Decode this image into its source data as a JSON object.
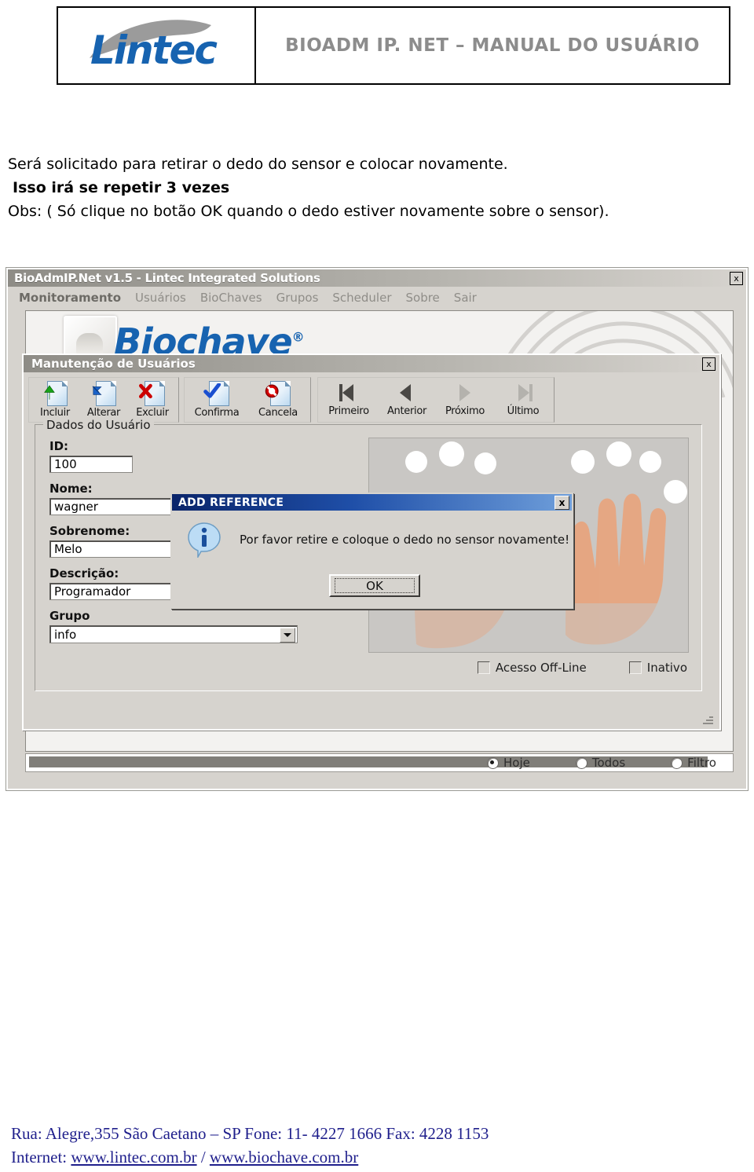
{
  "header": {
    "logo_text": "Lintec",
    "manual_title": "BIOADM IP. NET – MANUAL DO USUÁRIO"
  },
  "document_text": {
    "line1": "Será solicitado para retirar o dedo do sensor e colocar novamente.",
    "line2": " Isso irá se repetir 3 vezes",
    "line3": "Obs: ( Só clique no botão OK quando o dedo estiver novamente sobre o sensor)."
  },
  "app_window": {
    "title": "BioAdmIP.Net v1.5 - Lintec Integrated Solutions",
    "close_label": "x",
    "menu": [
      {
        "label": "Monitoramento",
        "active": true
      },
      {
        "label": "Usuários",
        "active": false
      },
      {
        "label": "BioChaves",
        "active": false
      },
      {
        "label": "Grupos",
        "active": false
      },
      {
        "label": "Scheduler",
        "active": false
      },
      {
        "label": "Sobre",
        "active": false
      },
      {
        "label": "Sair",
        "active": false
      }
    ],
    "brand_logo": "Biochave",
    "brand_mark": "®",
    "filter_radios": [
      {
        "label": "Hoje",
        "selected": true
      },
      {
        "label": "Todos",
        "selected": false
      },
      {
        "label": "Filtro",
        "selected": false
      }
    ]
  },
  "mdi_window": {
    "title": "Manutenção de Usuários",
    "close_label": "x",
    "toolbar": [
      {
        "label": "Incluir",
        "icon": "add-document-icon"
      },
      {
        "label": "Alterar",
        "icon": "edit-document-icon"
      },
      {
        "label": "Excluir",
        "icon": "delete-document-icon"
      },
      {
        "label": "Confirma",
        "icon": "confirm-check-icon"
      },
      {
        "label": "Cancela",
        "icon": "cancel-forbidden-icon"
      },
      {
        "label": "Primeiro",
        "icon": "first-record-icon"
      },
      {
        "label": "Anterior",
        "icon": "previous-record-icon"
      },
      {
        "label": "Próximo",
        "icon": "next-record-icon"
      },
      {
        "label": "Último",
        "icon": "last-record-icon"
      }
    ],
    "groupbox_legend": "Dados do Usuário",
    "fields": [
      {
        "label": "ID:",
        "value": "100",
        "type": "text"
      },
      {
        "label": "Nome:",
        "value": "wagner",
        "type": "text"
      },
      {
        "label": "Sobrenome:",
        "value": "Melo",
        "type": "text"
      },
      {
        "label": "Descrição:",
        "value": "Programador",
        "type": "text"
      },
      {
        "label": "Grupo",
        "value": "info",
        "type": "combo"
      }
    ],
    "checkboxes": [
      {
        "label": "Acesso Off-Line",
        "checked": false
      },
      {
        "label": "Inativo",
        "checked": false
      }
    ]
  },
  "modal": {
    "title": "ADD REFERENCE",
    "close_label": "x",
    "message": "Por favor retire e coloque o dedo no sensor novamente!",
    "ok_label": "OK",
    "icon": "info-icon",
    "title_color": "#0a246a"
  },
  "footer": {
    "line1": "Rua: Alegre,355  São Caetano – SP  Fone: 11- 4227 1666  Fax: 4228 1153",
    "internet_label": "Internet: ",
    "link1": "www.lintec.com.br",
    "separator": " / ",
    "link2": "www.biochave.com.br"
  }
}
